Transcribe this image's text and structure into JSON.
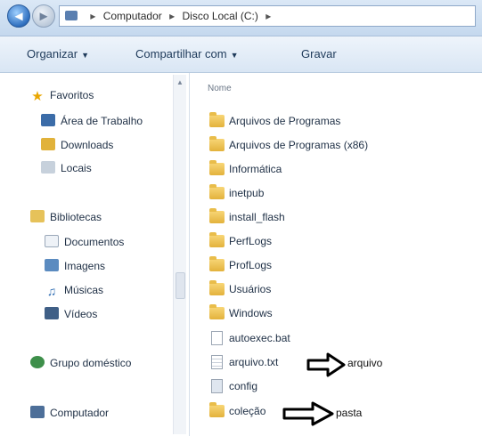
{
  "window": {
    "address_parts": [
      "Computador",
      "Disco Local (C:)"
    ]
  },
  "toolbar": {
    "organize": "Organizar",
    "share": "Compartilhar com",
    "burn": "Gravar"
  },
  "nav": {
    "favorites": "Favoritos",
    "desktop": "Área de Trabalho",
    "downloads": "Downloads",
    "recent": "Locais",
    "libraries": "Bibliotecas",
    "documents": "Documentos",
    "images": "Imagens",
    "music": "Músicas",
    "videos": "Vídeos",
    "homegroup": "Grupo doméstico",
    "computer": "Computador"
  },
  "content": {
    "column_name": "Nome",
    "items": [
      {
        "label": "Arquivos de Programas",
        "kind": "folder"
      },
      {
        "label": "Arquivos de Programas (x86)",
        "kind": "folder"
      },
      {
        "label": "Informática",
        "kind": "folder"
      },
      {
        "label": "inetpub",
        "kind": "folder"
      },
      {
        "label": "install_flash",
        "kind": "folder"
      },
      {
        "label": "PerfLogs",
        "kind": "folder"
      },
      {
        "label": "ProfLogs",
        "kind": "folder"
      },
      {
        "label": "Usuários",
        "kind": "folder"
      },
      {
        "label": "Windows",
        "kind": "folder"
      },
      {
        "label": "autoexec.bat",
        "kind": "file"
      },
      {
        "label": "arquivo.txt",
        "kind": "cfg"
      },
      {
        "label": "config",
        "kind": "exe"
      },
      {
        "label": "coleção",
        "kind": "folder"
      }
    ]
  },
  "annotations": {
    "arrow1_label": "arquivo",
    "arrow2_label": "pasta"
  }
}
